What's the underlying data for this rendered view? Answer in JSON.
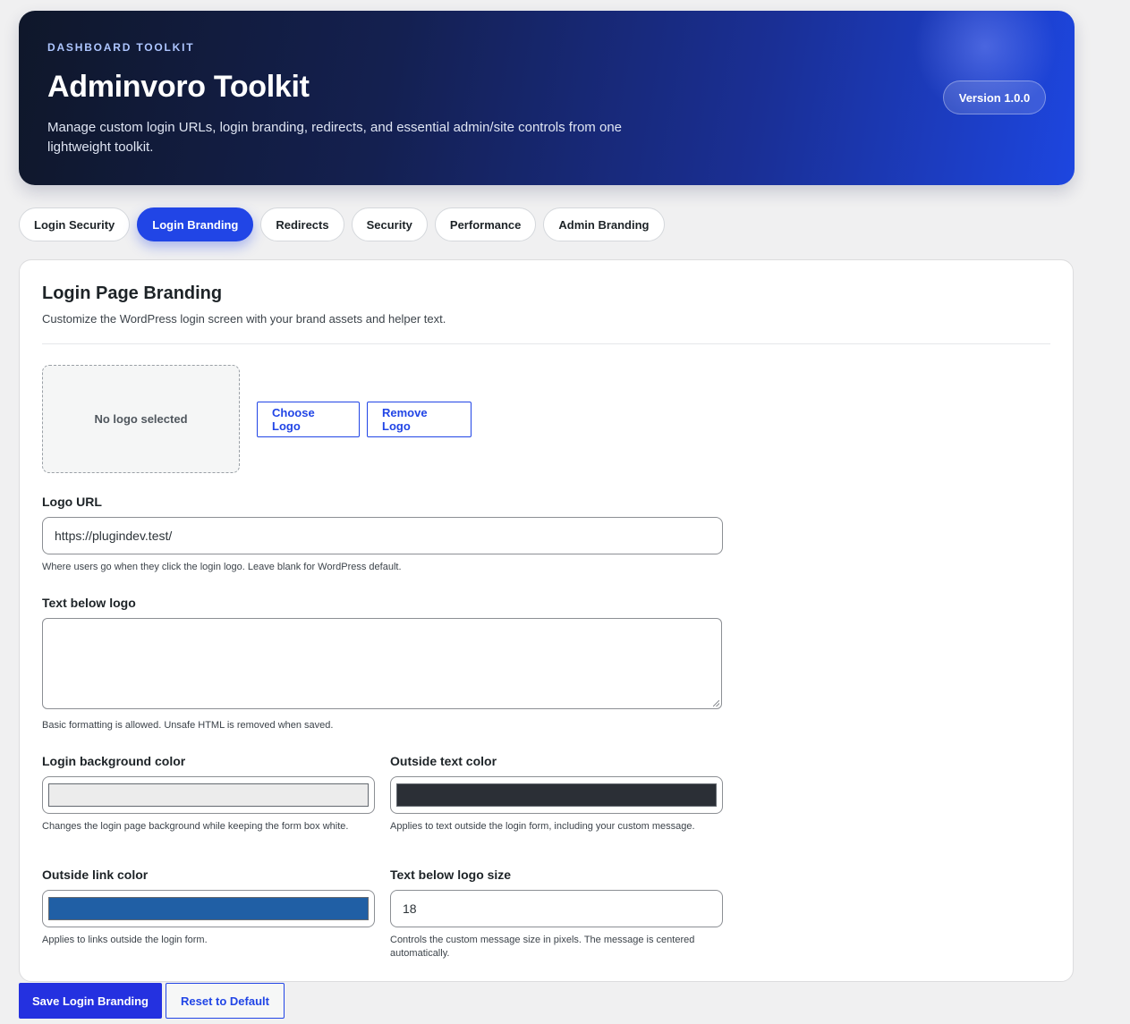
{
  "header": {
    "eyebrow": "DASHBOARD TOOLKIT",
    "title": "Adminvoro Toolkit",
    "description": "Manage custom login URLs, login branding, redirects, and essential admin/site controls from one lightweight toolkit.",
    "version": "Version 1.0.0"
  },
  "tabs": [
    {
      "label": "Login Security",
      "active": false
    },
    {
      "label": "Login Branding",
      "active": true
    },
    {
      "label": "Redirects",
      "active": false
    },
    {
      "label": "Security",
      "active": false
    },
    {
      "label": "Performance",
      "active": false
    },
    {
      "label": "Admin Branding",
      "active": false
    }
  ],
  "section": {
    "title": "Login Page Branding",
    "subtitle": "Customize the WordPress login screen with your brand assets and helper text."
  },
  "logo": {
    "placeholder": "No logo selected",
    "choose_label": "Choose Logo",
    "remove_label": "Remove Logo"
  },
  "fields": {
    "logo_url": {
      "label": "Logo URL",
      "value": "https://plugindev.test/",
      "help": "Where users go when they click the login logo. Leave blank for WordPress default."
    },
    "text_below_logo": {
      "label": "Text below logo",
      "value": "",
      "help": "Basic formatting is allowed. Unsafe HTML is removed when saved."
    },
    "login_bg_color": {
      "label": "Login background color",
      "color": "#ececec",
      "help": "Changes the login page background while keeping the form box white."
    },
    "outside_text_color": {
      "label": "Outside text color",
      "color": "#2b2f36",
      "help": "Applies to text outside the login form, including your custom message."
    },
    "outside_link_color": {
      "label": "Outside link color",
      "color": "#205fa5",
      "help": "Applies to links outside the login form."
    },
    "text_below_logo_size": {
      "label": "Text below logo size",
      "value": "18",
      "help": "Controls the custom message size in pixels. The message is centered automatically."
    }
  },
  "actions": {
    "save_label": "Save Login Branding",
    "reset_label": "Reset to Default"
  },
  "colors": {
    "accent": "#2145e6",
    "background": "#f0f0f1"
  }
}
